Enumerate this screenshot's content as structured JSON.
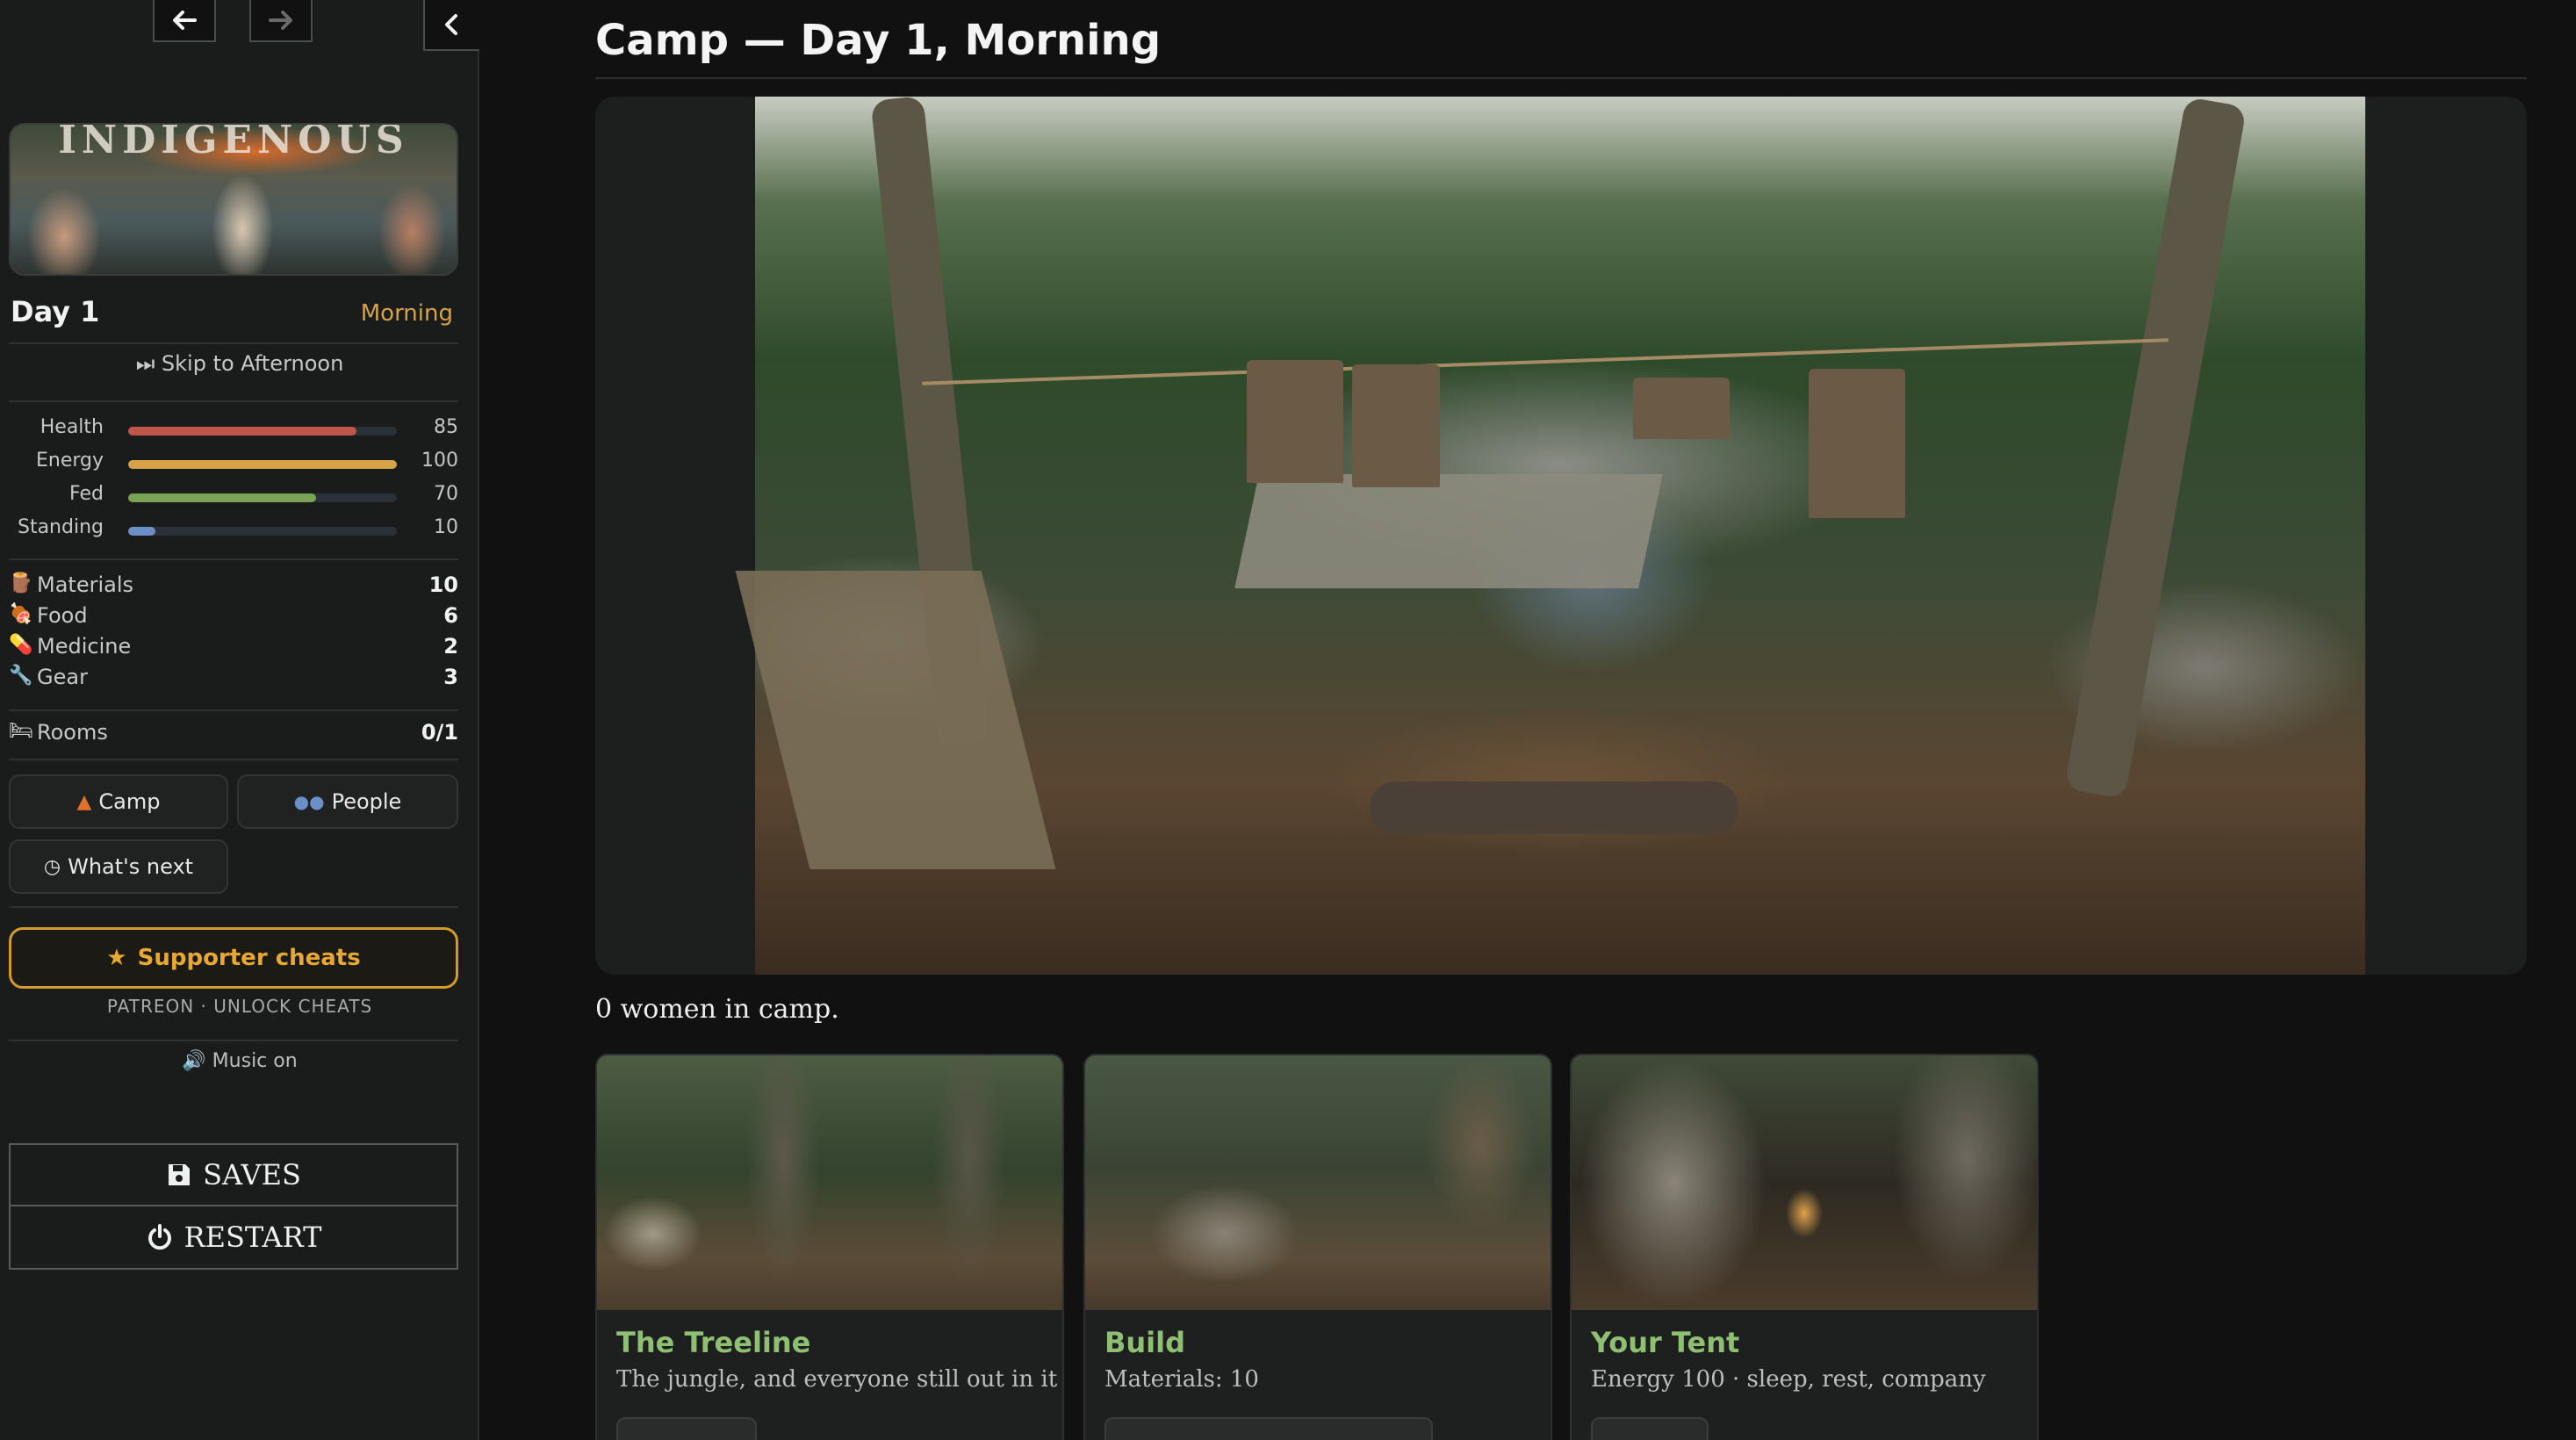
{
  "sidebar": {
    "thumbnail_title": "INDIGENOUS",
    "day": "Day 1",
    "time_of_day": "Morning",
    "skip_label": "⏭ Skip to Afternoon",
    "stats": [
      {
        "label": "Health",
        "value": "85",
        "fill": 0.85,
        "color": "#c0554a"
      },
      {
        "label": "Energy",
        "value": "100",
        "fill": 1.0,
        "color": "#d6a24a"
      },
      {
        "label": "Fed",
        "value": "70",
        "fill": 0.7,
        "color": "#7ba356"
      },
      {
        "label": "Standing",
        "value": "10",
        "fill": 0.1,
        "color": "#6d8fc7"
      }
    ],
    "resources": [
      {
        "icon": "🪵",
        "label": "Materials",
        "value": "10"
      },
      {
        "icon": "🍖",
        "label": "Food",
        "value": "6"
      },
      {
        "icon": "💊",
        "label": "Medicine",
        "value": "2"
      },
      {
        "icon": "🔧",
        "label": "Gear",
        "value": "3"
      }
    ],
    "rooms": {
      "icon": "🛏",
      "label": "Rooms",
      "value": "0/1"
    },
    "buttons": {
      "camp": "Camp",
      "people": "People",
      "whats_next": "What's next"
    },
    "supporter_label": "Supporter cheats",
    "patreon_line": "PATREON · UNLOCK CHEATS",
    "music_label": "🔊 Music on",
    "saves_label": "SAVES",
    "restart_label": "RESTART"
  },
  "main": {
    "title": "Camp — Day 1, Morning",
    "women_count": "0 women in camp.",
    "cards": [
      {
        "title": "The Treeline",
        "subtitle": "The jungle, and everyone still out in it"
      },
      {
        "title": "Build",
        "subtitle": "Materials: 10"
      },
      {
        "title": "Your Tent",
        "subtitle": "Energy 100 · sleep, rest, company"
      }
    ]
  },
  "colors": {
    "accent_gold": "#d39b2c",
    "card_title_green": "#8fbf72",
    "time_label": "#d6a24a"
  },
  "icons": {
    "back": "arrow-left-icon",
    "forward": "arrow-right-icon",
    "collapse": "chevron-left-icon",
    "camp": "campfire-icon",
    "people": "people-icon",
    "whats_next": "clock-icon",
    "supporter": "star-icon",
    "saves": "floppy-disk-icon",
    "restart": "power-icon"
  }
}
